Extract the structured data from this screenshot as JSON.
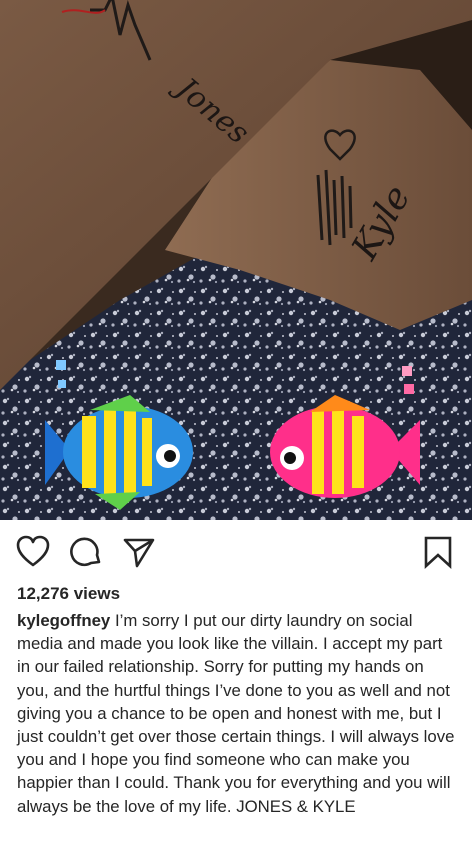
{
  "post": {
    "views": "12,276 views",
    "username": "kylegoffney",
    "caption": "I’m sorry I put our dirty laundry on social media and made you look like the villain. I accept my part in our failed relationship. Sorry for putting my hands on you, and the hurtful things I’ve done to you as well and not giving you a chance to be open and honest with me, but I just couldn’t get over those certain things. I will always love you and I hope you find someone who can make you happier than I could. Thank you for everything and you will always be the love of my life. JONES & KYLE",
    "photo": {
      "tattoo_left": "Jones",
      "tattoo_right": "Kyle"
    }
  },
  "icons": {
    "like": "heart-outline-icon",
    "comment": "speech-bubble-icon",
    "share": "paper-plane-icon",
    "save": "bookmark-icon"
  },
  "colors": {
    "text": "#262626",
    "background": "#ffffff",
    "fish_blue": "#2a8de0",
    "fish_pink": "#ff2f8a",
    "fish_yellow": "#ffe21a"
  }
}
